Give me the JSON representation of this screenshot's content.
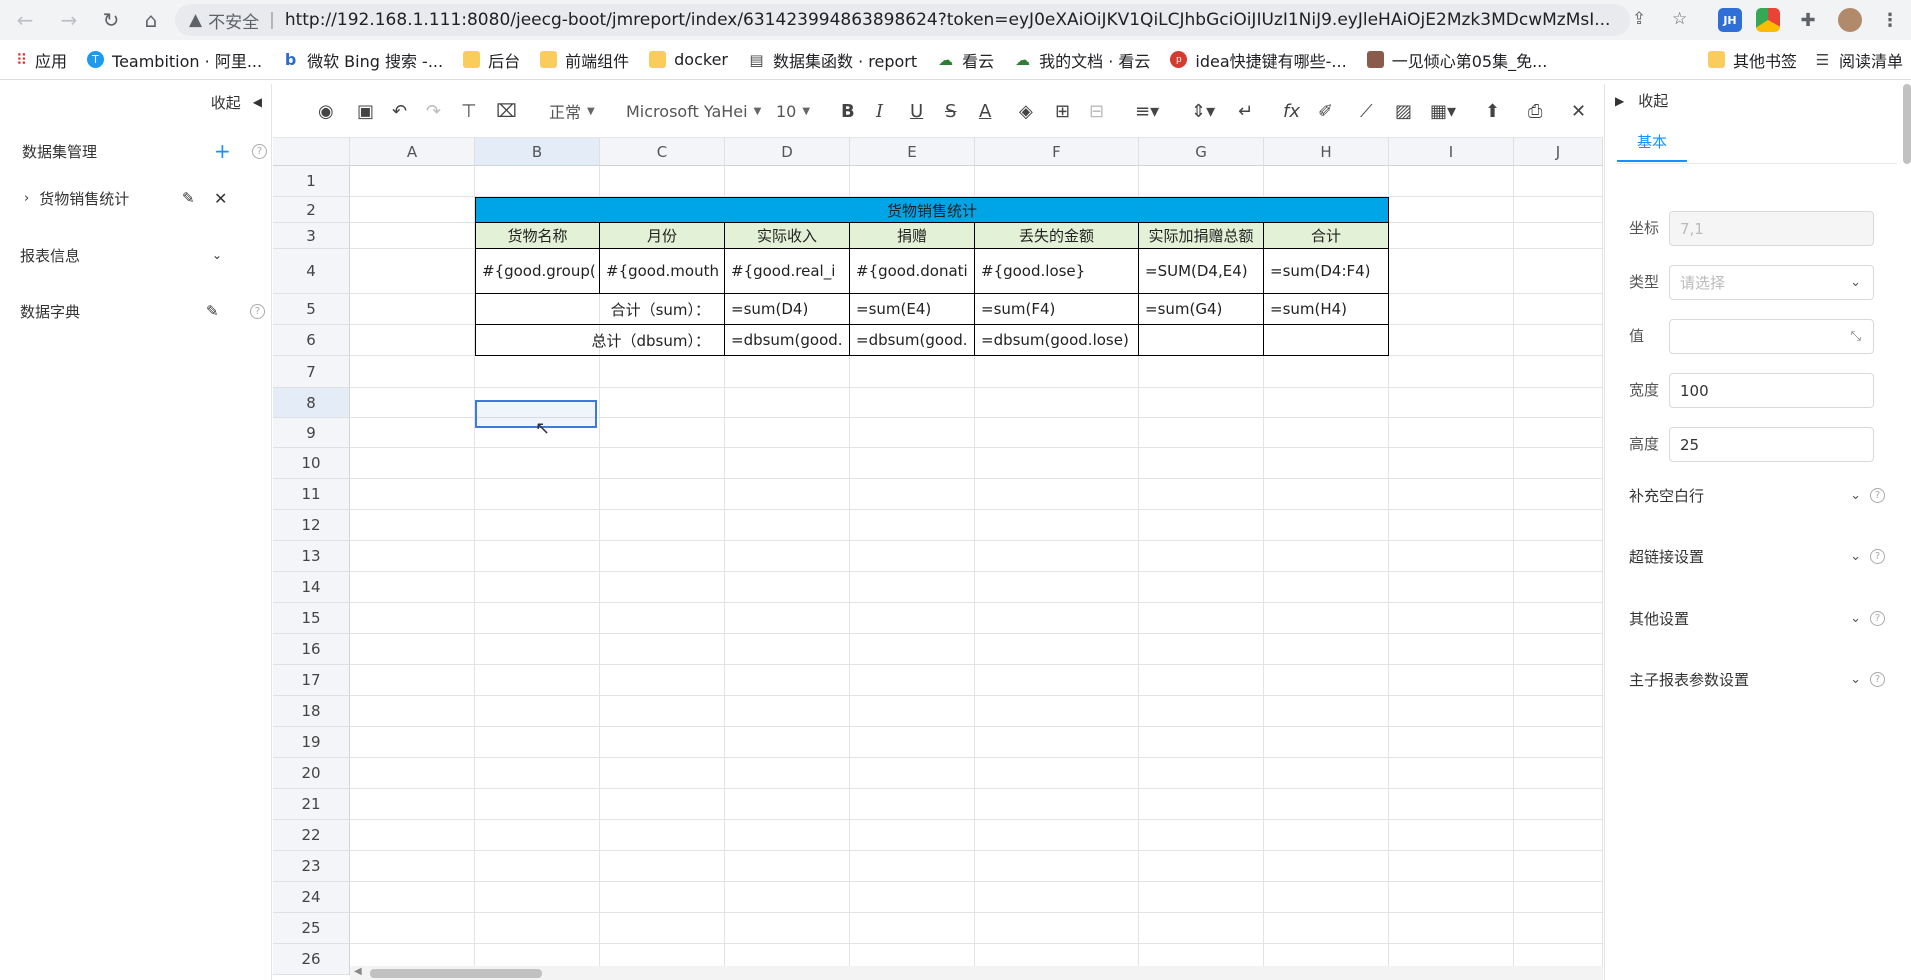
{
  "browser": {
    "insecure": "不安全",
    "url": "http://192.168.1.111:8080/jeecg-boot/jmreport/index/631423994863898624?token=eyJ0eXAiOiJKV1QiLCJhbGciOiJIUzI1NiJ9.eyJleHAiOjE2Mzk3MDcwMzMsI...",
    "ext_jh": "JH"
  },
  "bookmarks": [
    {
      "label": "应用",
      "icon": "apps-grid-icon"
    },
    {
      "label": "Teambition · 阿里...",
      "icon": "teambition-icon"
    },
    {
      "label": "微软 Bing 搜索 -...",
      "icon": "bing-icon"
    },
    {
      "label": "后台",
      "icon": "folder-icon"
    },
    {
      "label": "前端组件",
      "icon": "folder-icon"
    },
    {
      "label": "docker",
      "icon": "folder-icon"
    },
    {
      "label": "数据集函数 · report",
      "icon": "book-icon"
    },
    {
      "label": "看云",
      "icon": "kancloud-icon"
    },
    {
      "label": "我的文档 · 看云",
      "icon": "kancloud-icon"
    },
    {
      "label": "idea快捷键有哪些-...",
      "icon": "php-icon"
    },
    {
      "label": "一见倾心第05集_免...",
      "icon": "video-icon"
    }
  ],
  "bookmarks_right": {
    "other": "其他书签",
    "reading": "阅读清单"
  },
  "sidebar": {
    "collapse": "收起",
    "dataset_mgmt": "数据集管理",
    "dataset_item": "货物销售统计",
    "report_info": "报表信息",
    "data_dict": "数据字典"
  },
  "toolbar": {
    "style": "正常",
    "font": "Microsoft YaHei",
    "size": "10"
  },
  "sheet": {
    "columns": [
      "A",
      "B",
      "C",
      "D",
      "E",
      "F",
      "G",
      "H",
      "I",
      "J"
    ],
    "rows": [
      "1",
      "2",
      "3",
      "4",
      "5",
      "6",
      "7",
      "8",
      "9",
      "10",
      "11",
      "12",
      "13",
      "14",
      "15",
      "16",
      "17",
      "18",
      "19",
      "20",
      "21",
      "22",
      "23",
      "24",
      "25",
      "26"
    ],
    "title": "货物销售统计",
    "headers": [
      "货物名称",
      "月份",
      "实际收入",
      "捐赠",
      "丢失的金额",
      "实际加捐赠总额",
      "合计"
    ],
    "row4": [
      "#{good.group(",
      "#{good.mouth",
      "#{good.real_i",
      "#{good.donati",
      "#{good.lose}",
      "=SUM(D4,E4)",
      "=sum(D4:F4)"
    ],
    "row5": {
      "label": "合计（sum）：",
      "values": [
        "=sum(D4)",
        "=sum(E4)",
        "=sum(F4)",
        "=sum(G4)",
        "=sum(H4)"
      ]
    },
    "row6": {
      "label": "总计（dbsum）：",
      "values": [
        "=dbsum(good.",
        "=dbsum(good.",
        "=dbsum(good.lose)",
        "",
        ""
      ]
    }
  },
  "rpanel": {
    "collapse": "收起",
    "tab": "基本",
    "coord_label": "坐标",
    "coord_value": "7,1",
    "type_label": "类型",
    "type_placeholder": "请选择",
    "value_label": "值",
    "width_label": "宽度",
    "width_value": "100",
    "height_label": "高度",
    "height_value": "25",
    "sections": [
      "补充空白行",
      "超链接设置",
      "其他设置",
      "主子报表参数设置"
    ]
  },
  "colors": {
    "accent": "#1890ff",
    "title_bg": "#00a5e8",
    "header_bg": "#e3f1d7",
    "selection": "#3d7bdb"
  }
}
